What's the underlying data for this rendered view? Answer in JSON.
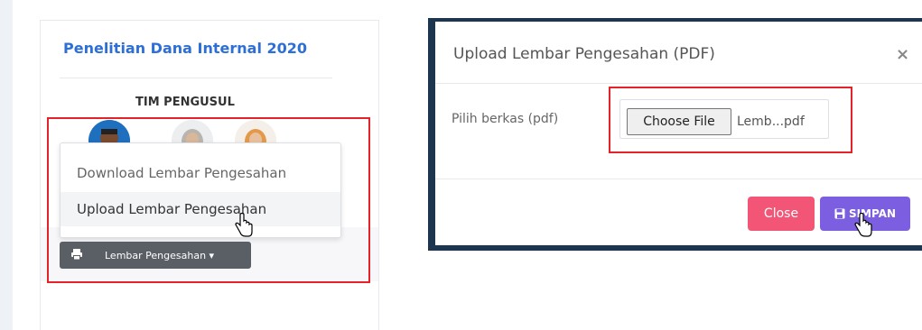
{
  "card": {
    "title": "Penelitian Dana Internal 2020",
    "team_label": "TIM PENGUSUL",
    "dropdown": {
      "items": [
        {
          "label": "Download Lembar Pengesahan"
        },
        {
          "label": "Upload Lembar Pengesahan"
        }
      ]
    },
    "button_label": "Lembar Pengesahan ▾",
    "button_icon": "printer-icon"
  },
  "modal": {
    "title": "Upload Lembar Pengesahan (PDF)",
    "close_symbol": "×",
    "field_label": "Pilih berkas (pdf)",
    "file_button": "Choose File",
    "file_name": "Lemb...pdf",
    "close_button": "Close",
    "save_button": "SIMPAN",
    "save_icon": "floppy-disk-icon"
  },
  "colors": {
    "highlight_red": "#e4222a",
    "title_blue": "#2d6fd6",
    "close_pink": "#f25576",
    "save_purple": "#7b5fe0",
    "modal_frame": "#1e3550"
  }
}
